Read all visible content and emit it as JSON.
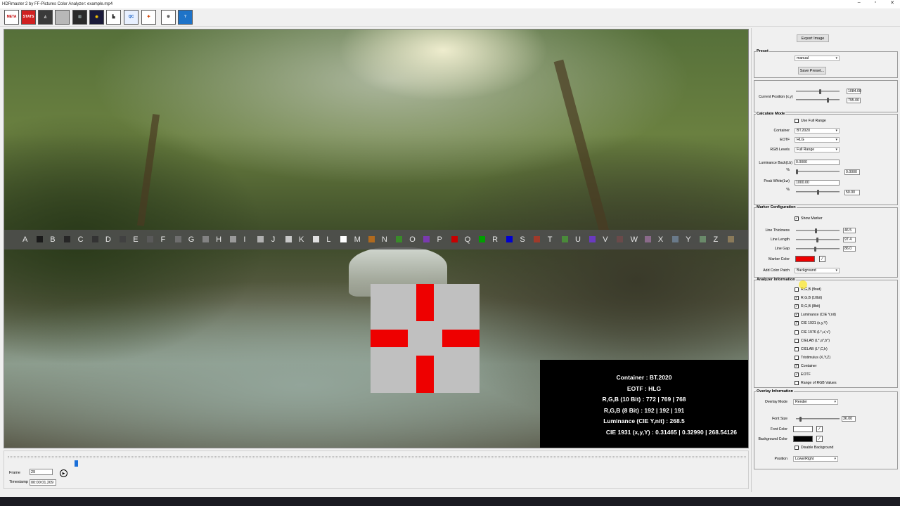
{
  "window": {
    "title": "HDRmaster 2 by FF-Pictures Color Analyzer: example.mp4",
    "min": "–",
    "max": "▫",
    "close": "✕"
  },
  "toolbar": [
    {
      "name": "meta-button",
      "label": "META",
      "bg": "#ffffff",
      "fg": "#c00000"
    },
    {
      "name": "stats-button",
      "label": "STATS",
      "bg": "#d02020",
      "fg": "#ffffff"
    },
    {
      "name": "gamut-button",
      "label": "◭",
      "bg": "#3a3a3a",
      "fg": "#cccccc"
    },
    {
      "name": "blank-button",
      "label": "",
      "bg": "#b8b8b8",
      "fg": "#ffffff"
    },
    {
      "name": "waveform-button",
      "label": "▥",
      "bg": "#2a2a2a",
      "fg": "#9aa"
    },
    {
      "name": "vectorscope-button",
      "label": "◉",
      "bg": "#1a1a3a",
      "fg": "#ffcc00"
    },
    {
      "name": "histogram-button",
      "label": "▙",
      "bg": "#ffffff",
      "fg": "#333"
    },
    {
      "name": "qc-button",
      "label": "QC",
      "bg": "#e8f0ff",
      "fg": "#0050c0"
    },
    {
      "name": "compare-button",
      "label": "✚",
      "bg": "#ffffff",
      "fg": "#d04000"
    },
    {
      "name": "settings-button",
      "label": "⚙",
      "bg": "#ffffff",
      "fg": "#000000"
    },
    {
      "name": "help-button",
      "label": "?",
      "bg": "#1e73c8",
      "fg": "#ffffff"
    }
  ],
  "patches": [
    {
      "letter": "A",
      "color": "#1a1a1a"
    },
    {
      "letter": "B",
      "color": "#262626"
    },
    {
      "letter": "C",
      "color": "#333333"
    },
    {
      "letter": "D",
      "color": "#414141"
    },
    {
      "letter": "E",
      "color": "#5a5a5a"
    },
    {
      "letter": "F",
      "color": "#6e6e6e"
    },
    {
      "letter": "G",
      "color": "#838383"
    },
    {
      "letter": "H",
      "color": "#9a9a9a"
    },
    {
      "letter": "I",
      "color": "#b0b0b0"
    },
    {
      "letter": "J",
      "color": "#c8c8c8"
    },
    {
      "letter": "K",
      "color": "#e0e0e0"
    },
    {
      "letter": "L",
      "color": "#ffffff"
    },
    {
      "letter": "M",
      "color": "#b06a1e"
    },
    {
      "letter": "N",
      "color": "#3a8a2a"
    },
    {
      "letter": "O",
      "color": "#7a3ab0"
    },
    {
      "letter": "P",
      "color": "#c80000"
    },
    {
      "letter": "Q",
      "color": "#00a000"
    },
    {
      "letter": "R",
      "color": "#0000d0"
    },
    {
      "letter": "S",
      "color": "#a03a2a"
    },
    {
      "letter": "T",
      "color": "#4a8a3a"
    },
    {
      "letter": "U",
      "color": "#6a3ac0"
    },
    {
      "letter": "V",
      "color": "#6a4a4a"
    },
    {
      "letter": "W",
      "color": "#8a6a8a"
    },
    {
      "letter": "X",
      "color": "#6a7a8a"
    },
    {
      "letter": "Y",
      "color": "#6a8a6a"
    },
    {
      "letter": "Z",
      "color": "#8a7a5a"
    },
    {
      "letter": "",
      "color": "#7a6aa0"
    }
  ],
  "overlay": {
    "container": "Container : BT.2020",
    "eotf": "EOTF : HLG",
    "rgb10": "R,G,B (10 Bit) : 772 | 769 | 768",
    "rgb8": "R,G,B (8 Bit) : 192 | 192 | 191",
    "luminance": "Luminance (CIE Y,nit) : 268.5",
    "cie": "CIE 1931 (x,y,Y) : 0.31465 | 0.32990 | 268.54126"
  },
  "transport": {
    "frame_label": "Frame",
    "frame_value": "29",
    "timestamp_label": "Timestamp",
    "timestamp_value": "00:00:01.209",
    "progress": 0.09
  },
  "panel": {
    "export_image": "Export Image",
    "preset": {
      "title": "Preset",
      "value": "manual",
      "save": "Save Preset..."
    },
    "position": {
      "label": "Current Position (x,y)",
      "x": "1084.00",
      "y": "795.00"
    },
    "calc": {
      "title": "Calculate Mode",
      "full_range": "Use Full Range",
      "container_label": "Container",
      "container": "BT.2020",
      "eotf_label": "EOTF",
      "eotf": "HLG",
      "rgb_label": "RGB Levels",
      "rgb": "Full Range",
      "lum_label": "Luminance Back(Lb)",
      "lum": "0.0000",
      "pct1": "%",
      "lum_pct": "0.0000",
      "peak_label": "Peak White(Lw)",
      "peak": "1000.00",
      "pct2": "%",
      "peak_pct": "50.00"
    },
    "marker": {
      "title": "Marker Configuration",
      "show": "Show Marker",
      "thick_label": "Line Thickness",
      "thick": "46.5",
      "len_label": "Line Length",
      "len": "97.4",
      "gap_label": "Line Gap",
      "gap": "86.0",
      "color_label": "Marker Color",
      "color": "#ee0000",
      "patch_label": "Add Color Patch",
      "patch": "Background"
    },
    "analyzer": {
      "title": "Analyzer Information",
      "items": [
        {
          "label": "R,G,B (float)",
          "checked": false
        },
        {
          "label": "R,G,B (10bit)",
          "checked": true
        },
        {
          "label": "R,G,B (8bit)",
          "checked": true
        },
        {
          "label": "Luminance (CIE Y,nit)",
          "checked": true
        },
        {
          "label": "CIE 1931 (x,y,Y)",
          "checked": true
        },
        {
          "label": "CIE 1976 (L*,u',v')",
          "checked": false
        },
        {
          "label": "CIELAB (L*,a*,b*)",
          "checked": false
        },
        {
          "label": "CIELAB (L*,C,h)",
          "checked": false
        },
        {
          "label": "Tristimulus (X,Y,Z)",
          "checked": false
        },
        {
          "label": "Container",
          "checked": true
        },
        {
          "label": "EOTF",
          "checked": true
        },
        {
          "label": "Range of RGB Values",
          "checked": false
        }
      ]
    },
    "overlay_info": {
      "title": "Overlay Information",
      "mode_label": "Overlay Mode",
      "mode": "Render",
      "font_size_label": "Font Size",
      "font_size": "36.00",
      "font_color_label": "Font Color",
      "font_color": "#ffffff",
      "bg_label": "Background Color",
      "bg_color": "#000000",
      "disable_bg": "Disable Background",
      "pos_label": "Position",
      "pos": "LowerRight"
    }
  }
}
